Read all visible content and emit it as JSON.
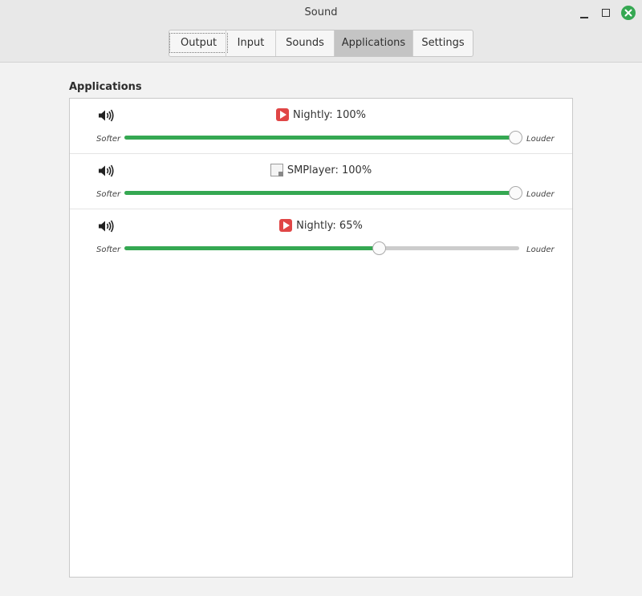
{
  "window": {
    "title": "Sound"
  },
  "tabs": [
    {
      "label": "Output",
      "focused": true,
      "active": false
    },
    {
      "label": "Input",
      "focused": false,
      "active": false
    },
    {
      "label": "Sounds",
      "focused": false,
      "active": false
    },
    {
      "label": "Applications",
      "focused": false,
      "active": true
    },
    {
      "label": "Settings",
      "focused": false,
      "active": false
    }
  ],
  "applications": {
    "section_title": "Applications",
    "items": [
      {
        "header": "Nightly: 100%",
        "icon": "nightly-icon",
        "volume": 100,
        "softer_label": "Softer",
        "louder_label": "Louder"
      },
      {
        "header": "SMPlayer: 100%",
        "icon": "smplayer-icon",
        "volume": 100,
        "softer_label": "Softer",
        "louder_label": "Louder"
      },
      {
        "header": "Nightly: 65%",
        "icon": "nightly-icon",
        "volume": 65,
        "softer_label": "Softer",
        "louder_label": "Louder"
      }
    ]
  },
  "colors": {
    "accent": "#35a852",
    "track": "#cccccc",
    "close_button": "#35a852"
  }
}
